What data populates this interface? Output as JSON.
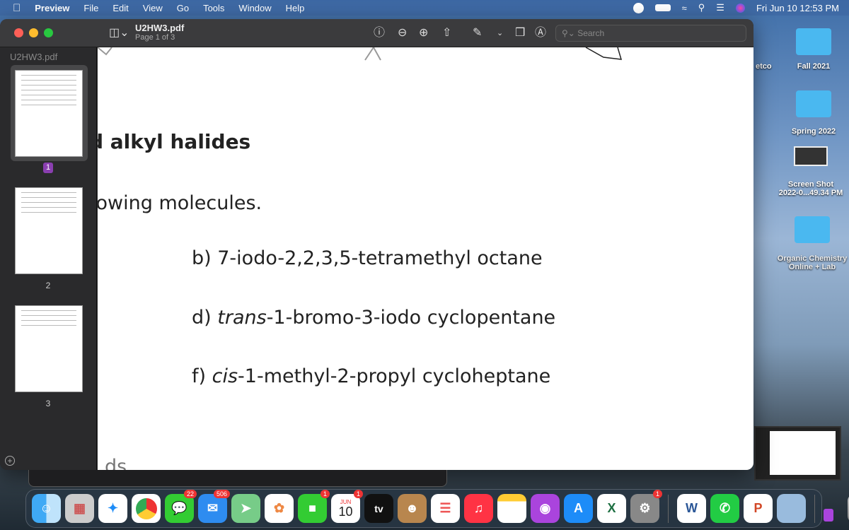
{
  "menubar": {
    "apple": "",
    "app": "Preview",
    "items": [
      "File",
      "Edit",
      "View",
      "Go",
      "Tools",
      "Window",
      "Help"
    ],
    "clock": "Fri Jun 10  12:53 PM",
    "status_icons": [
      "grammarly-icon",
      "battery-icon",
      "wifi-icon",
      "search-icon",
      "control-center-icon",
      "siri-icon"
    ]
  },
  "window": {
    "title": "U2HW3.pdf",
    "subtitle": "Page 1 of 3",
    "search_placeholder": "Search"
  },
  "sidebar": {
    "title": "U2HW3.pdf",
    "pages": [
      {
        "label": "1",
        "selected": true
      },
      {
        "label": "2"
      },
      {
        "label": "3"
      }
    ]
  },
  "document": {
    "heading": "d alkyl halides",
    "instruction": "lowing molecules.",
    "items": [
      "b) 7-iodo-2,2,3,5-tetramethyl octane",
      "d) ",
      "trans",
      "-1-bromo-3-iodo cyclopentane",
      "f) ",
      "cis",
      "-1-methyl-2-propyl cycloheptane"
    ],
    "bottom": "ds"
  },
  "desktop": {
    "items": [
      "etco",
      "Fall 2021",
      "Spring 2022",
      "Screen Shot\n2022-0...49.34 PM",
      "Organic Chemistry\nOnline + Lab"
    ]
  },
  "dock": {
    "apps": [
      {
        "name": "finder"
      },
      {
        "name": "launchpad"
      },
      {
        "name": "safari"
      },
      {
        "name": "chrome"
      },
      {
        "name": "messages",
        "badge": "22"
      },
      {
        "name": "mail",
        "badge": "506"
      },
      {
        "name": "maps"
      },
      {
        "name": "photos"
      },
      {
        "name": "facetime",
        "badge": "1"
      },
      {
        "name": "calendar",
        "badge": "1",
        "month": "JUN",
        "day": "10"
      },
      {
        "name": "tv",
        "label": "tv"
      },
      {
        "name": "contacts"
      },
      {
        "name": "reminders"
      },
      {
        "name": "music"
      },
      {
        "name": "notes"
      },
      {
        "name": "podcasts"
      },
      {
        "name": "app-store"
      },
      {
        "name": "excel",
        "label": "X"
      },
      {
        "name": "system-preferences",
        "badge": "1"
      },
      {
        "name": "word",
        "label": "W"
      },
      {
        "name": "whatsapp"
      },
      {
        "name": "powerpoint",
        "label": "P"
      },
      {
        "name": "preview"
      }
    ]
  }
}
